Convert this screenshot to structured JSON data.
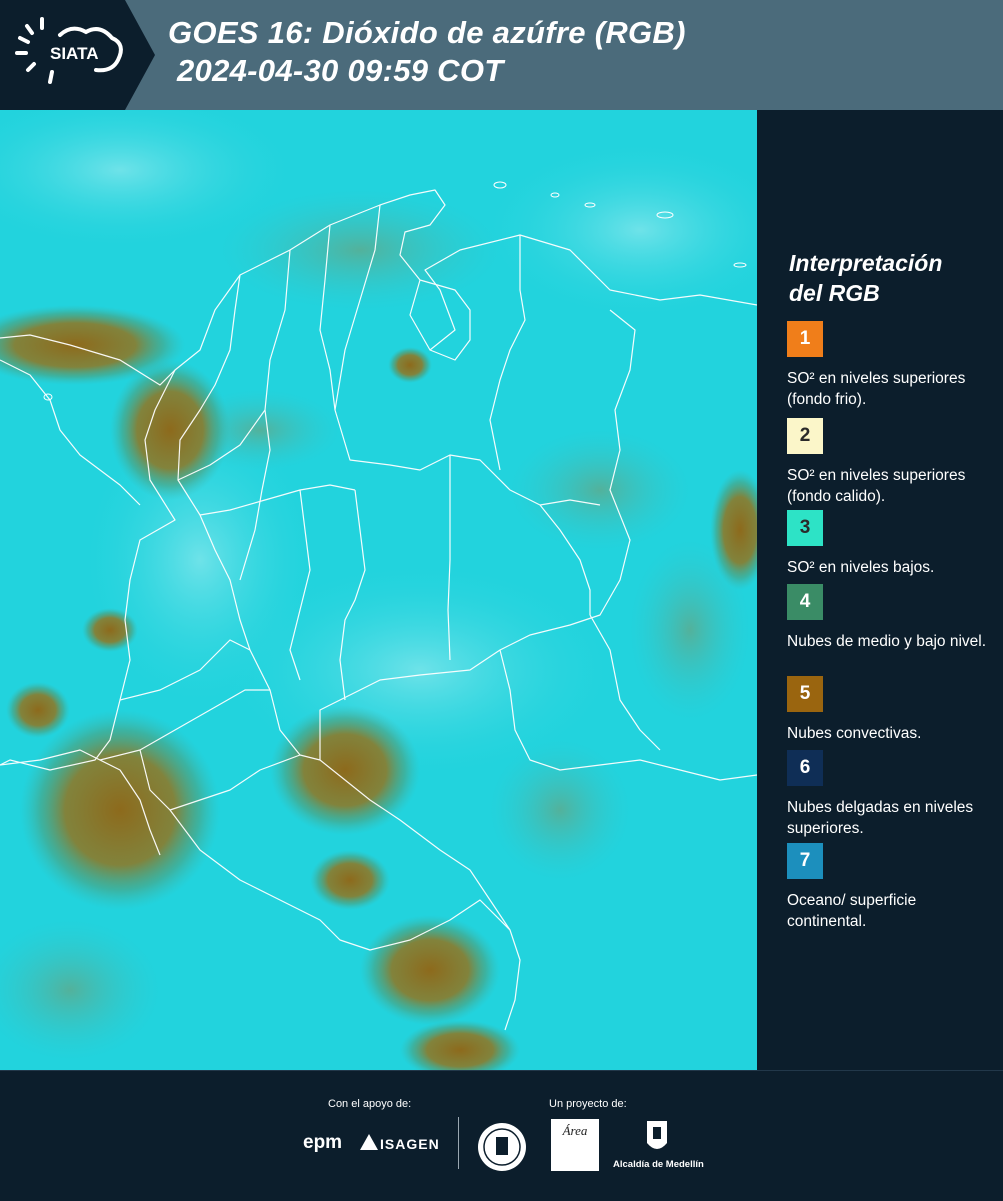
{
  "header": {
    "logo_text": "SIATA",
    "title_line1": "GOES 16: Dióxido de azúfre (RGB)",
    "title_line2": "2024-04-30 09:59 COT"
  },
  "legend": {
    "title_line1": "Interpretación",
    "title_line2": "del RGB",
    "items": [
      {
        "num": "1",
        "color": "#f07e1a",
        "text": "SO² en niveles superiores (fondo frio)."
      },
      {
        "num": "2",
        "color": "#fbf6c9",
        "text": "SO² en niveles superiores (fondo calido)."
      },
      {
        "num": "3",
        "color": "#2de3c6",
        "text": "SO² en niveles bajos."
      },
      {
        "num": "4",
        "color": "#3a8c66",
        "text": "Nubes de medio y bajo nivel."
      },
      {
        "num": "5",
        "color": "#9a650f",
        "text": "Nubes convectivas."
      },
      {
        "num": "6",
        "color": "#0f2e56",
        "text": "Nubes delgadas en niveles superiores."
      },
      {
        "num": "7",
        "color": "#1c8fbd",
        "text": "Oceano/ superficie continental."
      }
    ]
  },
  "footer": {
    "support_label": "Con el apoyo de:",
    "project_label": "Un proyecto de:",
    "sponsor1": "epm",
    "sponsor2": "ISAGEN",
    "partner1_text": "Área",
    "partner2_name": "Alcaldía de Medellín"
  },
  "colors": {
    "header_bg": "#4b6b7b",
    "panel_bg": "#0c1e2c",
    "map_cyan": "#22d3dd",
    "cloud_brown": "#9a7420",
    "border_line": "#ffffff"
  }
}
